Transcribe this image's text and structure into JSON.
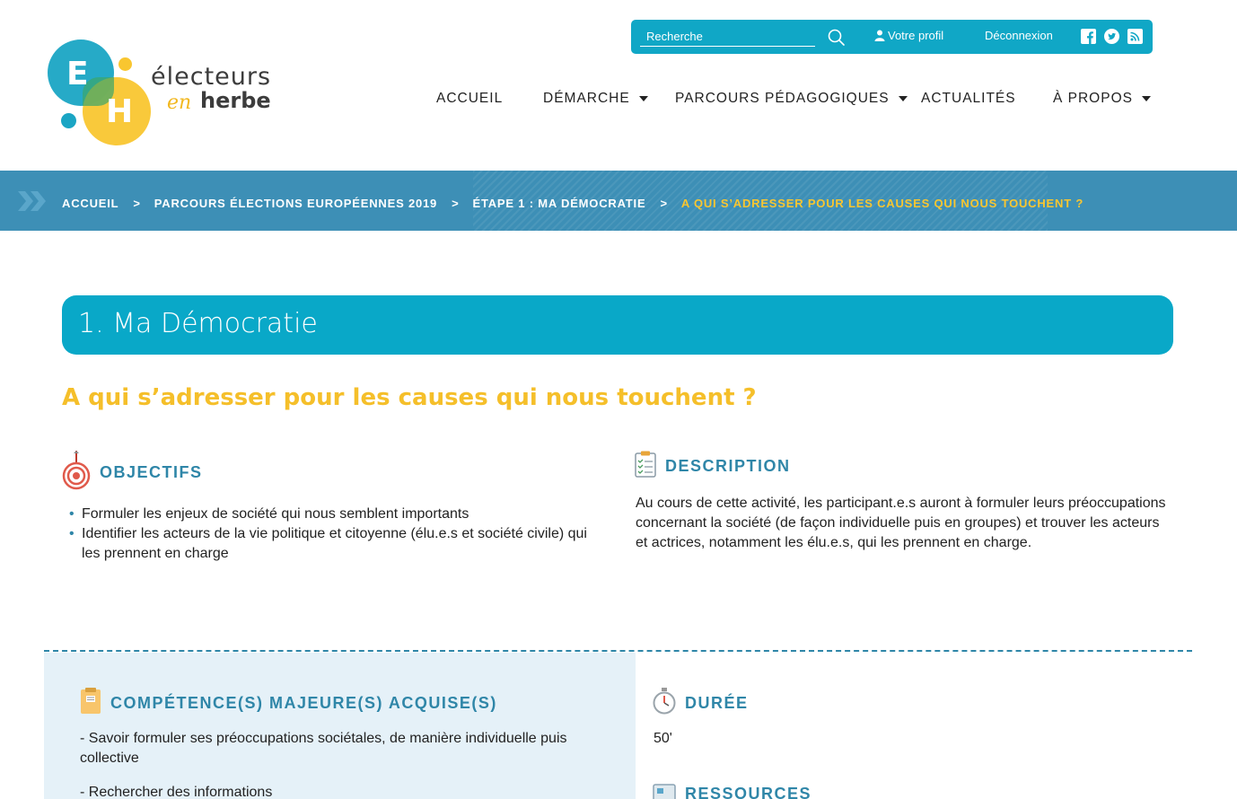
{
  "logo": {
    "letter_e": "E",
    "letter_h": "H",
    "word1": "électeurs",
    "word2": "en",
    "word3": "herbe"
  },
  "topbar": {
    "search_placeholder": "Recherche",
    "profile_label": "Votre profil",
    "logout_label": "Déconnexion",
    "color": "#10a7c6"
  },
  "nav": {
    "items": [
      {
        "label": "ACCUEIL",
        "dropdown": false
      },
      {
        "label": "DÉMARCHE",
        "dropdown": true
      },
      {
        "label": "PARCOURS PÉDAGOGIQUES",
        "dropdown": true
      },
      {
        "label": "ACTUALITÉS",
        "dropdown": false
      },
      {
        "label": "À PROPOS",
        "dropdown": true
      }
    ]
  },
  "breadcrumb": {
    "items": [
      "ACCUEIL",
      "PARCOURS ÉLECTIONS EUROPÉENNES 2019",
      "ÉTAPE 1 : MA DÉMOCRATIE"
    ],
    "separator": ">",
    "current": "A QUI S’ADRESSER POUR LES CAUSES QUI NOUS TOUCHENT ?"
  },
  "step": {
    "title": "1. Ma Démocratie"
  },
  "activity": {
    "title": "A qui s’adresser pour les causes qui nous touchent ?"
  },
  "objectives": {
    "heading": "OBJECTIFS",
    "items": [
      "Formuler les enjeux de société qui nous semblent importants",
      "Identifier les acteurs de la vie politique et citoyenne (élu.e.s et société civile) qui les prennent en charge"
    ]
  },
  "description": {
    "heading": "DESCRIPTION",
    "text": "Au cours de cette activité, les participant.e.s auront à formuler leurs préoccupations concernant la société (de façon individuelle puis en groupes) et trouver les acteurs et actrices, notamment les élu.e.s, qui les prennent en charge."
  },
  "competences": {
    "heading": "COMPÉTENCE(S) MAJEURE(S) ACQUISE(S)",
    "items": [
      "- Savoir formuler ses préoccupations sociétales, de manière individuelle puis collective",
      "- Rechercher des informations"
    ]
  },
  "duration": {
    "heading": "DURÉE",
    "value": "50'"
  },
  "resources": {
    "heading": "RESSOURCES"
  },
  "colors": {
    "brand_blue": "#09a8c8",
    "brand_yellow": "#f9c630",
    "heading_blue": "#2f86a8",
    "breadcrumb_bg": "#3d8fb6"
  }
}
